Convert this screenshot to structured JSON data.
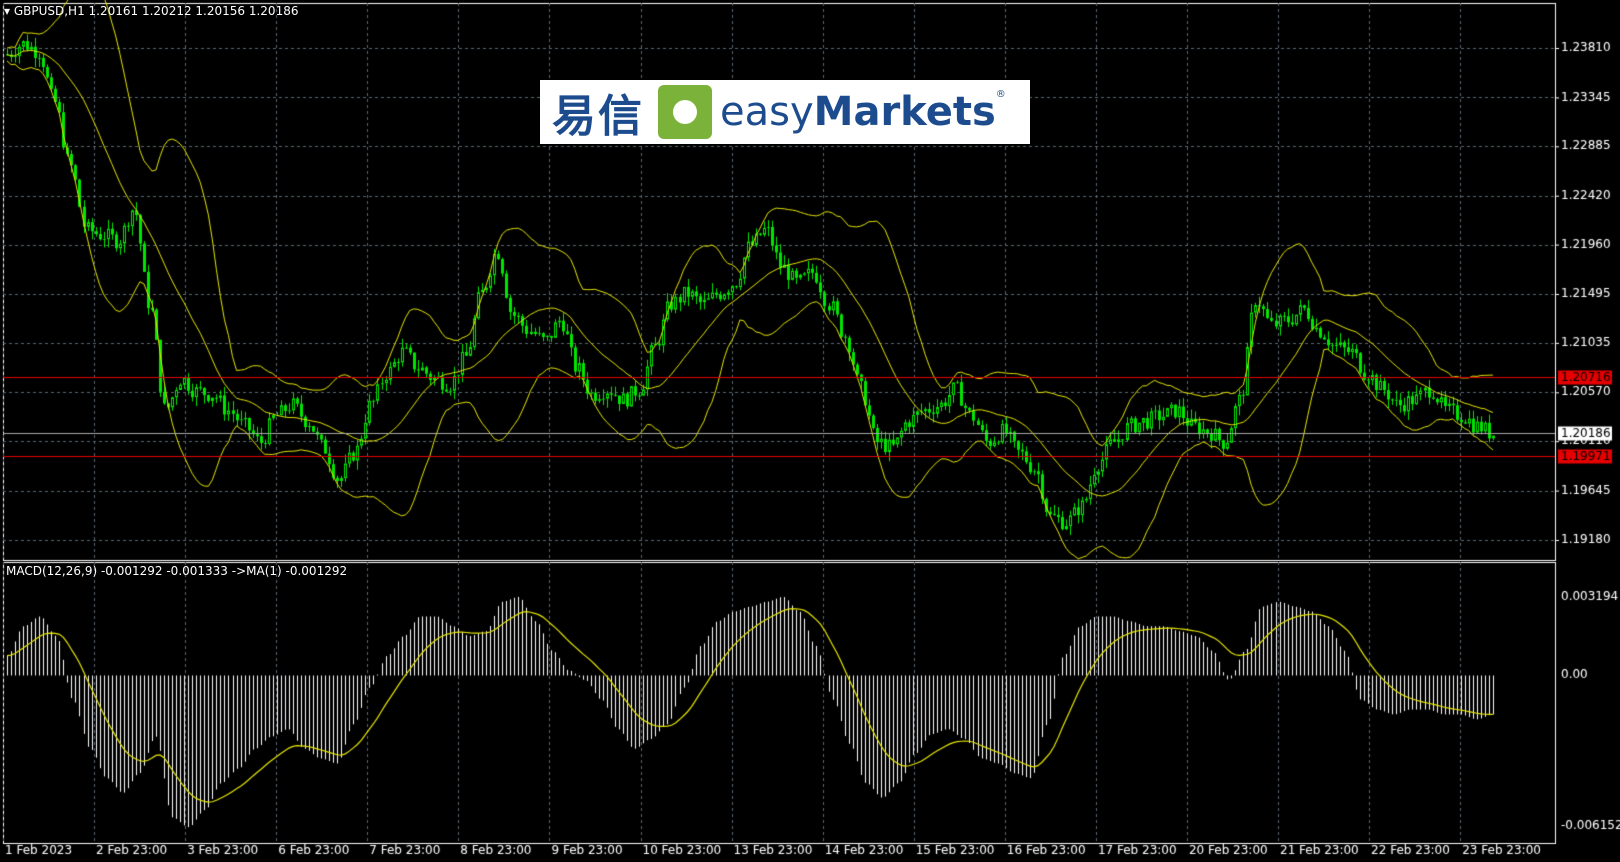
{
  "header": {
    "symbol_line": "▾ GBPUSD,H1  1.20161 1.20212 1.20156 1.20186"
  },
  "logo": {
    "cn": "易信",
    "en_prefix": "easy",
    "en_suffix": "Markets",
    "reg": "®"
  },
  "colors": {
    "background": "#000000",
    "grid": "#5a6470",
    "candle": "#00e600",
    "bands": "#e6e600",
    "hline": "#e60000",
    "hist": "#ffffff",
    "signal": "#e6e600",
    "axis_text": "#ffffff"
  },
  "chart_data": [
    {
      "type": "candlestick",
      "title": "GBPUSD,H1",
      "ylim": [
        1.1918,
        1.2381
      ],
      "y_ticks": [
        "1.23810",
        "1.23345",
        "1.22885",
        "1.22420",
        "1.21960",
        "1.21495",
        "1.21035",
        "1.20570",
        "1.20110",
        "1.19645",
        "1.19180"
      ],
      "x_ticks": [
        "1 Feb 2023",
        "2 Feb 23:00",
        "3 Feb 23:00",
        "6 Feb 23:00",
        "7 Feb 23:00",
        "8 Feb 23:00",
        "9 Feb 23:00",
        "10 Feb 23:00",
        "13 Feb 23:00",
        "14 Feb 23:00",
        "15 Feb 23:00",
        "16 Feb 23:00",
        "17 Feb 23:00",
        "20 Feb 23:00",
        "21 Feb 23:00",
        "22 Feb 23:00",
        "23 Feb 23:00"
      ],
      "price_close_path": [
        1.2375,
        1.2385,
        1.2378,
        1.233,
        1.227,
        1.221,
        1.2205,
        1.22,
        1.223,
        1.214,
        1.204,
        1.207,
        1.2058,
        1.2055,
        1.204,
        1.2025,
        1.201,
        1.2035,
        1.2045,
        1.203,
        1.2005,
        1.1975,
        1.2,
        1.2045,
        1.2075,
        1.2095,
        1.208,
        1.207,
        1.2065,
        1.209,
        1.215,
        1.219,
        1.213,
        1.2115,
        1.2105,
        1.2125,
        1.208,
        1.2055,
        1.206,
        1.205,
        1.206,
        1.21,
        1.214,
        1.215,
        1.214,
        1.215,
        1.216,
        1.2195,
        1.221,
        1.2175,
        1.216,
        1.217,
        1.214,
        1.211,
        1.206,
        1.201,
        1.2005,
        1.203,
        1.204,
        1.2045,
        1.206,
        1.2035,
        1.201,
        1.202,
        1.2,
        1.1985,
        1.194,
        1.1935,
        1.195,
        1.199,
        1.201,
        1.2025,
        1.203,
        1.2035,
        1.204,
        1.2025,
        1.202,
        1.201,
        1.205,
        1.2145,
        1.212,
        1.2125,
        1.2135,
        1.2115,
        1.21,
        1.2095,
        1.2075,
        1.206,
        1.2045,
        1.205,
        1.206,
        1.204,
        1.2035,
        1.2025,
        1.2018
      ],
      "horizontal_lines": [
        {
          "label": "1.20716",
          "value": 1.20716
        },
        {
          "label": "1.19971",
          "value": 1.19971
        }
      ],
      "current_price": {
        "label": "1.20186",
        "value": 1.20186
      }
    },
    {
      "type": "macd",
      "title": "MACD(12,26,9) -0.001292 -0.001333  ->MA(1) -0.001292",
      "ylim": [
        -0.006152,
        0.003194
      ],
      "y_ticks": [
        "0.003194",
        "0.00",
        "-0.006152"
      ],
      "hist_path": [
        0.0008,
        0.002,
        0.0024,
        0.0016,
        -0.001,
        -0.003,
        -0.0042,
        -0.0048,
        -0.004,
        -0.0025,
        -0.0058,
        -0.0062,
        -0.0055,
        -0.0044,
        -0.0038,
        -0.003,
        -0.0025,
        -0.0022,
        -0.003,
        -0.0034,
        -0.0036,
        -0.002,
        -0.0005,
        0.0008,
        0.0016,
        0.0024,
        0.0024,
        0.002,
        0.0016,
        0.0018,
        0.003,
        0.0032,
        0.0022,
        0.001,
        0.0002,
        -0.0002,
        -0.001,
        -0.0022,
        -0.003,
        -0.0026,
        -0.002,
        -0.0005,
        0.0012,
        0.0022,
        0.0026,
        0.0028,
        0.003,
        0.0032,
        0.0026,
        0.0012,
        -0.001,
        -0.0028,
        -0.0044,
        -0.005,
        -0.0044,
        -0.0032,
        -0.0024,
        -0.0022,
        -0.0026,
        -0.0034,
        -0.0036,
        -0.004,
        -0.0042,
        -0.002,
        0.0008,
        0.002,
        0.0024,
        0.0024,
        0.0022,
        0.002,
        0.002,
        0.0018,
        0.0016,
        0.001,
        -0.0002,
        0.001,
        0.0028,
        0.003,
        0.0028,
        0.0026,
        0.002,
        0.001,
        -0.001,
        -0.0014,
        -0.0016,
        -0.0014,
        -0.0014,
        -0.0016,
        -0.0016,
        -0.0018,
        -0.0016
      ]
    }
  ]
}
